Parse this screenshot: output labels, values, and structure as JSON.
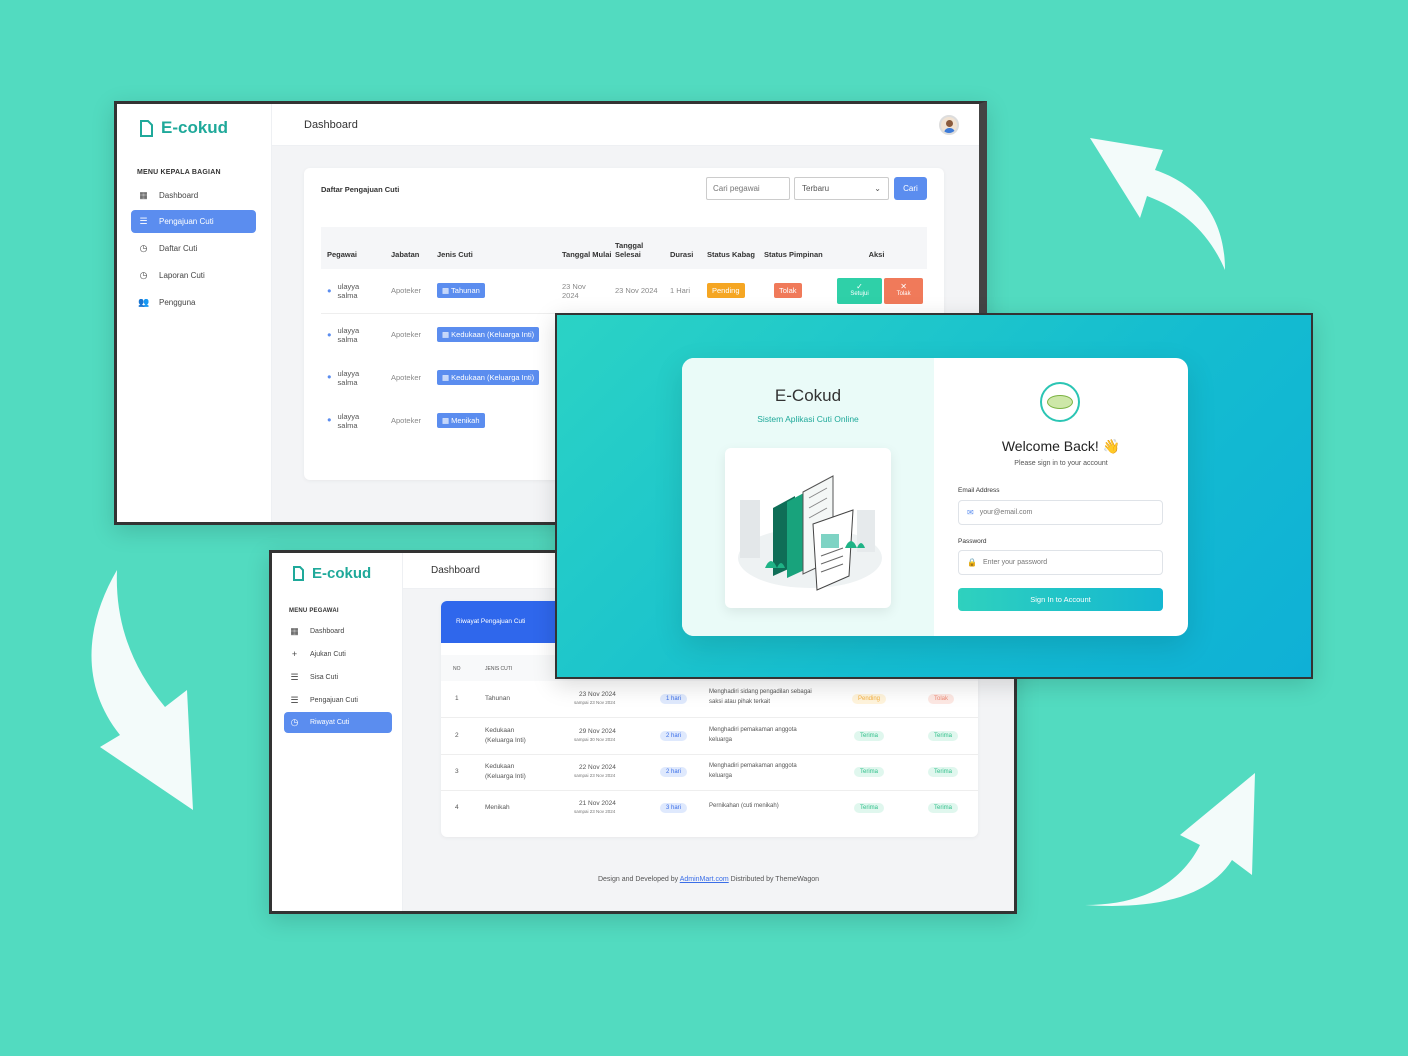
{
  "colors": {
    "background": "#52dbc0",
    "accent": "#5b8def",
    "teal": "#1fa99a"
  },
  "admin": {
    "logo_text": "E-cokud",
    "page_title": "Dashboard",
    "menu_header": "MENU KEPALA BAGIAN",
    "menu": [
      {
        "label": "Dashboard",
        "icon": "grid-icon"
      },
      {
        "label": "Pengajuan Cuti",
        "icon": "list-icon"
      },
      {
        "label": "Daftar Cuti",
        "icon": "history-icon"
      },
      {
        "label": "Laporan Cuti",
        "icon": "history-icon"
      },
      {
        "label": "Pengguna",
        "icon": "users-icon"
      }
    ],
    "card_title": "Daftar Pengajuan Cuti",
    "search_placeholder": "Cari pegawai",
    "sort_value": "Terbaru",
    "search_button": "Cari",
    "headers": [
      "Pegawai",
      "Jabatan",
      "Jenis Cuti",
      "Tanggal Mulai",
      "Tanggal Selesai",
      "Durasi",
      "Status Kabag",
      "Status Pimpinan",
      "Aksi"
    ],
    "rows": [
      {
        "name": "ulayya salma",
        "jabatan": "Apoteker",
        "jenis": "Tahunan",
        "mulai": "23 Nov 2024",
        "selesai": "23 Nov 2024",
        "durasi": "1 Hari",
        "status_kabag": "Pending",
        "status_pimpinan": "Tolak",
        "approve": "Setujui",
        "reject": "Tolak"
      },
      {
        "name": "ulayya salma",
        "jabatan": "Apoteker",
        "jenis": "Kedukaan (Keluarga Inti)"
      },
      {
        "name": "ulayya salma",
        "jabatan": "Apoteker",
        "jenis": "Kedukaan (Keluarga Inti)"
      },
      {
        "name": "ulayya salma",
        "jabatan": "Apoteker",
        "jenis": "Menikah"
      }
    ]
  },
  "employee": {
    "logo_text": "E-cokud",
    "page_title": "Dashboard",
    "menu_header": "MENU PEGAWAI",
    "menu": [
      {
        "label": "Dashboard",
        "icon": "grid-icon"
      },
      {
        "label": "Ajukan Cuti",
        "icon": "plus-icon"
      },
      {
        "label": "Sisa Cuti",
        "icon": "list-icon"
      },
      {
        "label": "Pengajuan Cuti",
        "icon": "list-icon"
      },
      {
        "label": "Riwayat Cuti",
        "icon": "history-icon"
      }
    ],
    "card_title": "Riwayat Pengajuan Cuti",
    "headers": [
      "NO",
      "JENIS CUTI"
    ],
    "rows": [
      {
        "no": "1",
        "jenis": "Tahunan",
        "tanggal": "23 Nov 2024",
        "sampai": "sampai 23 Nov 2024",
        "durasi": "1 hari",
        "alasan": "Menghadiri sidang pengadilan sebagai saksi atau pihak terkait",
        "s1": "Pending",
        "s2": "Tolak"
      },
      {
        "no": "2",
        "jenis": "Kedukaan (Keluarga Inti)",
        "tanggal": "29 Nov 2024",
        "sampai": "sampai 30 Nov 2024",
        "durasi": "2 hari",
        "alasan": "Menghadiri pemakaman anggota keluarga",
        "s1": "Terima",
        "s2": "Terima"
      },
      {
        "no": "3",
        "jenis": "Kedukaan (Keluarga Inti)",
        "tanggal": "22 Nov 2024",
        "sampai": "sampai 23 Nov 2024",
        "durasi": "2 hari",
        "alasan": "Menghadiri pemakaman anggota keluarga",
        "s1": "Terima",
        "s2": "Terima"
      },
      {
        "no": "4",
        "jenis": "Menikah",
        "tanggal": "21 Nov 2024",
        "sampai": "sampai 23 Nov 2024",
        "durasi": "3 hari",
        "alasan": "Pernikahan (cuti menikah)",
        "s1": "Terima",
        "s2": "Terima"
      }
    ],
    "footer_prefix": "Design and Developed by ",
    "footer_link": "AdminMart.com",
    "footer_suffix": " Distributed by ThemeWagon"
  },
  "login": {
    "title": "E-Cokud",
    "subtitle": "Sistem Aplikasi Cuti Online",
    "welcome": "Welcome Back!",
    "wave": "👋",
    "instruction": "Please sign in to your account",
    "email_label": "Email Address",
    "email_placeholder": "your@email.com",
    "password_label": "Password",
    "password_placeholder": "Enter your password",
    "submit": "Sign In to Account"
  }
}
